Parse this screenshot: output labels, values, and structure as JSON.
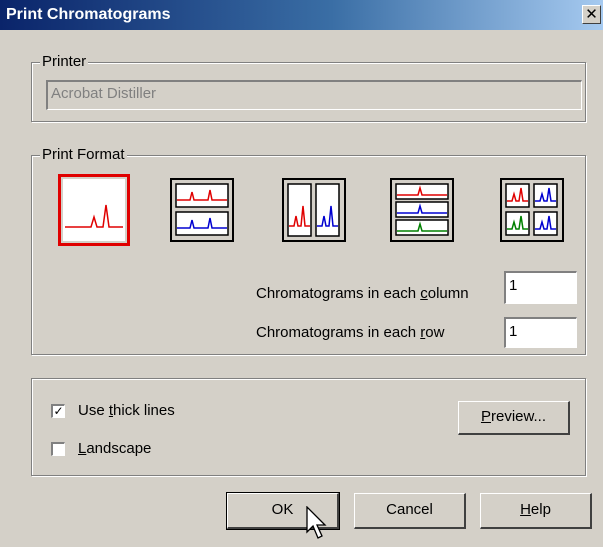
{
  "window": {
    "title": "Print Chromatograms",
    "close_glyph": "✕"
  },
  "printer": {
    "group_label": "Printer",
    "value": "Acrobat Distiller"
  },
  "format": {
    "group_label": "Print Format",
    "options": [
      {
        "name": "single",
        "selected": true
      },
      {
        "name": "two-rows",
        "selected": false
      },
      {
        "name": "two-columns",
        "selected": false
      },
      {
        "name": "three-rows",
        "selected": false
      },
      {
        "name": "grid-2x2",
        "selected": false
      }
    ],
    "column_label_pre": "Chromatograms in each ",
    "column_label_key": "c",
    "column_label_post": "olumn",
    "column_value": "1",
    "row_label_pre": "Chromatograms in each ",
    "row_label_key": "r",
    "row_label_post": "ow",
    "row_value": "1"
  },
  "options": {
    "thick_lines_pre": "Use ",
    "thick_lines_key": "t",
    "thick_lines_post": "hick lines",
    "thick_lines_checked": true,
    "landscape_key": "L",
    "landscape_post": "andscape",
    "landscape_checked": false,
    "preview_key": "P",
    "preview_post": "review..."
  },
  "buttons": {
    "ok": "OK",
    "cancel": "Cancel",
    "help_key": "H",
    "help_post": "elp"
  },
  "colors": {
    "red": "#e00000",
    "blue": "#0000d0",
    "green": "#008000",
    "titlebar": "#0a246a"
  }
}
